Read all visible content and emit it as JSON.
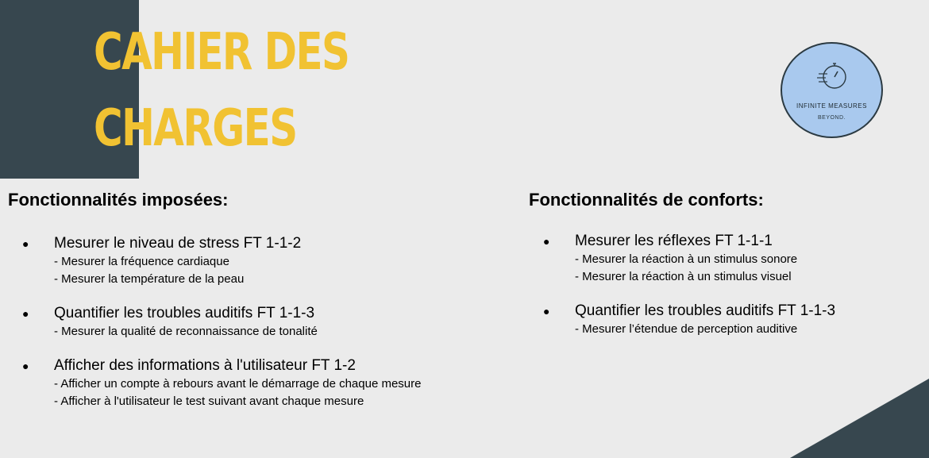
{
  "title": {
    "line1": "CAHIER DES",
    "line2": "CHARGES"
  },
  "logo": {
    "name": "INFINITE MEASURES",
    "tagline": "BEYOND."
  },
  "colors": {
    "accent": "#f1c232",
    "dark": "#37474f",
    "background": "#ebebeb",
    "logo_fill": "#a9c9ee"
  },
  "left": {
    "heading": "Fonctionnalités imposées:",
    "items": [
      {
        "bullet": "●",
        "title": "Mesurer le niveau de stress FT 1-1-2",
        "subs": [
          "- Mesurer la fréquence cardiaque",
          "- Mesurer la température de la peau"
        ]
      },
      {
        "bullet": "●",
        "title": "Quantifier les troubles auditifs FT 1-1-3",
        "subs": [
          "- Mesurer la qualité de reconnaissance de tonalité"
        ]
      },
      {
        "bullet": "●",
        "title": "Afficher des informations à l'utilisateur FT 1-2",
        "subs": [
          "- Afficher un compte à rebours avant le démarrage de chaque mesure",
          "- Afficher à l'utilisateur le test suivant avant chaque mesure"
        ]
      }
    ]
  },
  "right": {
    "heading": "Fonctionnalités de conforts:",
    "items": [
      {
        "bullet": "●",
        "title": "Mesurer les réflexes FT 1-1-1",
        "subs": [
          "- Mesurer la réaction à un stimulus sonore",
          "- Mesurer la réaction à un stimulus visuel"
        ]
      },
      {
        "bullet": "●",
        "title": "Quantifier les troubles auditifs FT 1-1-3",
        "subs": [
          "- Mesurer l’étendue de perception auditive"
        ]
      }
    ]
  }
}
